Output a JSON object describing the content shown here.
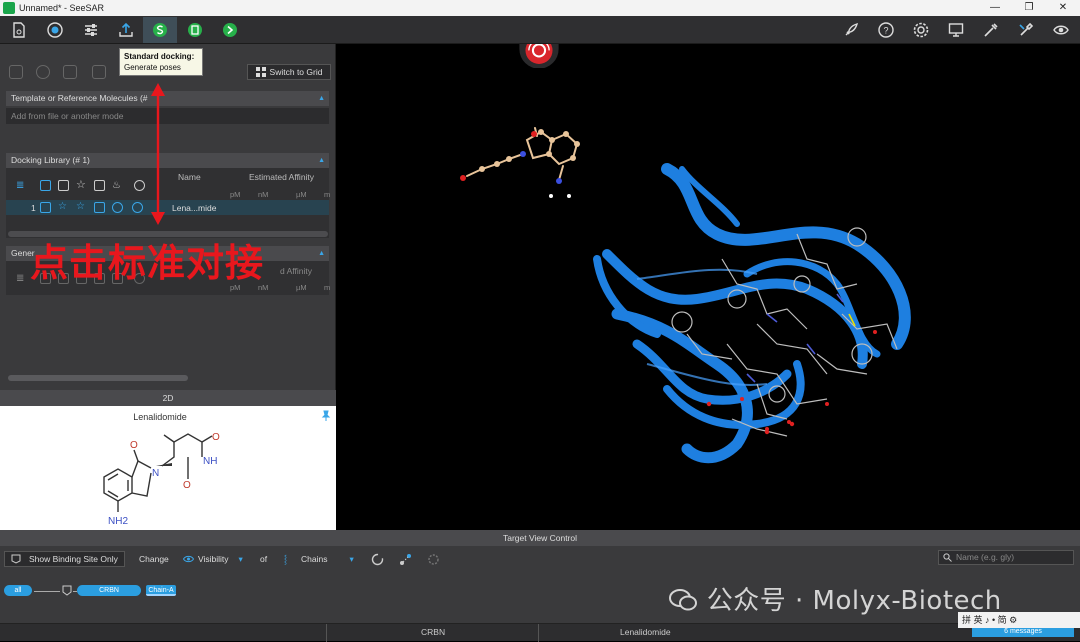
{
  "window": {
    "title": "Unnamed* - SeeSAR",
    "controls": [
      "—",
      "❐",
      "✕"
    ]
  },
  "toolbar": {
    "tooltip_title": "Standard docking:",
    "tooltip_text": "Generate poses"
  },
  "left_panel": {
    "switch_grid_label": "Switch to Grid",
    "template_section": "Template or Reference Molecules (#",
    "template_placeholder": "Add from file or another mode",
    "docking_library_title": "Docking Library (# 1)",
    "col_name": "Name",
    "col_affinity": "Estimated Affinity",
    "units": [
      "pM",
      "nM",
      "µM",
      "m"
    ],
    "row_index": "1",
    "row_name": "Lena...mide",
    "generated_section": "Gener",
    "generated_affinity_fragment": "d Affinity",
    "panel_2d_label": "2D",
    "molecule_name": "Lenalidomide",
    "atom_labels": {
      "o1": "O",
      "o2": "O",
      "n1": "N",
      "nh": "NH",
      "o3": "O",
      "nh2": "NH2"
    }
  },
  "annotation": {
    "text": "点击标准对接"
  },
  "bottom": {
    "header": "Target View Control",
    "show_binding_site_label": "Show Binding Site Only",
    "change_label": "Change",
    "visibility_label": "Visibility",
    "of_label": "of",
    "chains_label": "Chains",
    "search_placeholder": "Name (e.g. gly)",
    "chip_all": "all",
    "chip_crbn": "CRBN",
    "chip_chain": "Chain-A",
    "footer_crbn": "CRBN",
    "footer_ligand": "Lenalidomide",
    "messages": "6 messages"
  },
  "overlays": {
    "watermark": "公众号 · Molyx-Biotech",
    "ime": "拼 英 ♪ • 简 ⚙"
  },
  "colors": {
    "accent": "#2b9ee0",
    "annotation_red": "#e8171d",
    "protein_blue": "#1e7fe0",
    "ligand_carbon": "#e8c49a"
  },
  "icons": {
    "toolbar": [
      "file-icon",
      "target-icon",
      "sliders-icon",
      "upload-icon",
      "docking-icon",
      "inspect-icon",
      "forward-icon"
    ],
    "toolbar_right": [
      "rocket-icon",
      "help-icon",
      "gear-icon",
      "monitor-icon",
      "tools-icon",
      "wrench-icon",
      "eye-icon"
    ]
  }
}
